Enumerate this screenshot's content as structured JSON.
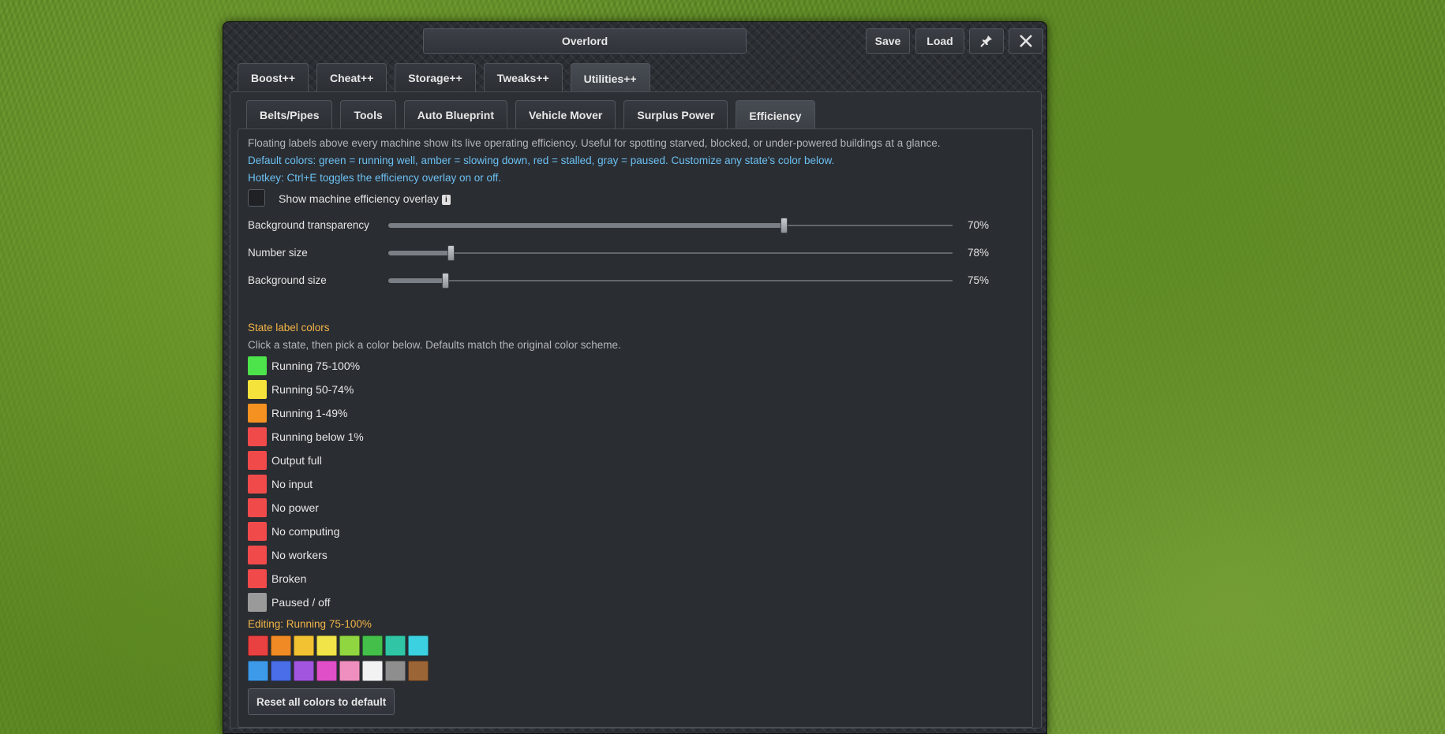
{
  "window": {
    "title": "Overlord",
    "save_label": "Save",
    "load_label": "Load"
  },
  "main_tabs": [
    {
      "label": "Boost++"
    },
    {
      "label": "Cheat++"
    },
    {
      "label": "Storage++"
    },
    {
      "label": "Tweaks++"
    },
    {
      "label": "Utilities++",
      "active": true
    }
  ],
  "sub_tabs": [
    {
      "label": "Belts/Pipes"
    },
    {
      "label": "Tools"
    },
    {
      "label": "Auto Blueprint"
    },
    {
      "label": "Vehicle Mover"
    },
    {
      "label": "Surplus Power"
    },
    {
      "label": "Efficiency",
      "active": true
    }
  ],
  "efficiency": {
    "description": "Floating labels above every machine show its live operating efficiency. Useful for spotting starved, blocked, or under-powered buildings at a glance.",
    "default_colors": "Default colors: green = running well, amber = slowing down, red = stalled, gray = paused. Customize any state's color below.",
    "hotkey": "Hotkey: Ctrl+E toggles the efficiency overlay on or off.",
    "overlay_label": "Show machine efficiency overlay",
    "overlay_checked": false,
    "sliders": [
      {
        "label": "Background transparency",
        "value": 70,
        "value_text": "70%"
      },
      {
        "label": "Number size",
        "value": 78,
        "value_text": "78%"
      },
      {
        "label": "Background size",
        "value": 75,
        "value_text": "75%"
      }
    ],
    "state_colors_heading": "State label colors",
    "state_colors_hint": "Click a state, then pick a color below. Defaults match the original color scheme.",
    "states": [
      {
        "label": "Running 75-100%",
        "color": "#4de34a"
      },
      {
        "label": "Running 50-74%",
        "color": "#f5e23a"
      },
      {
        "label": "Running 1-49%",
        "color": "#f59121"
      },
      {
        "label": "Running below 1%",
        "color": "#f04a4a"
      },
      {
        "label": "Output full",
        "color": "#f04a4a"
      },
      {
        "label": "No input",
        "color": "#f04a4a"
      },
      {
        "label": "No power",
        "color": "#f04a4a"
      },
      {
        "label": "No computing",
        "color": "#f04a4a"
      },
      {
        "label": "No workers",
        "color": "#f04a4a"
      },
      {
        "label": "Broken",
        "color": "#f04a4a"
      },
      {
        "label": "Paused / off",
        "color": "#9a9a9a"
      }
    ],
    "editing_label": "Editing: Running 75-100%",
    "palette_row1": [
      "#e94141",
      "#ef8a25",
      "#f2c232",
      "#f0e448",
      "#8fd640",
      "#43bf4a",
      "#2fc5a5",
      "#3cd1e0"
    ],
    "palette_row2": [
      "#3d9ae8",
      "#4a6de8",
      "#a256e0",
      "#e04fc8",
      "#ef8fbf",
      "#f2f2f2",
      "#8e8e8e",
      "#9b6536"
    ],
    "reset_label": "Reset all colors to default"
  }
}
